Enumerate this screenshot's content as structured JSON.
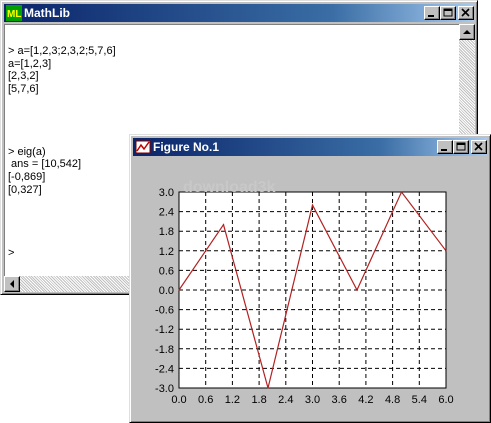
{
  "mathlib": {
    "title": "MathLib",
    "icon_label": "ML",
    "console_lines": [
      "> a=[1,2,3;2,3,2;5,7,6]",
      "a=[1,2,3]",
      "[2,3,2]",
      "[5,7,6]",
      "",
      "",
      "",
      "",
      "> eig(a)",
      " ans = [10,542]",
      "[-0,869]",
      "[0,327]",
      "",
      "",
      "",
      "",
      ">"
    ]
  },
  "figure": {
    "title": "Figure No.1",
    "watermark": "download3k"
  },
  "colors": {
    "title_bar": "#0a246a",
    "line": "#b22222",
    "plot_background": "#ffffff",
    "window": "#c0c0c0"
  },
  "chart_data": {
    "type": "line",
    "x": [
      0,
      1,
      2,
      3,
      4,
      5,
      6
    ],
    "series": [
      {
        "values": [
          0,
          2,
          -3,
          2.6,
          0,
          3,
          1.2
        ]
      }
    ],
    "xlim": [
      0,
      6
    ],
    "ylim": [
      -3,
      3
    ],
    "xticks": [
      "0.0",
      "0.6",
      "1.2",
      "1.8",
      "2.4",
      "3.0",
      "3.6",
      "4.2",
      "4.8",
      "5.4",
      "6.0"
    ],
    "yticks": [
      "3.0",
      "2.4",
      "1.8",
      "1.2",
      "0.6",
      "0.0",
      "-0.6",
      "-1.2",
      "-1.8",
      "-2.4",
      "-3.0"
    ],
    "grid": true,
    "title": "",
    "xlabel": "",
    "ylabel": ""
  }
}
